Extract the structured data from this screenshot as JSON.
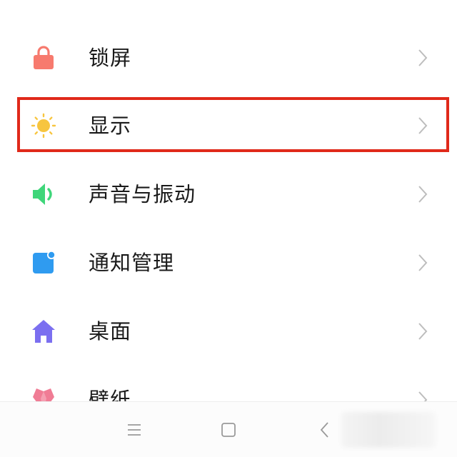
{
  "settings": {
    "items": [
      {
        "label": "锁屏",
        "icon": "lock-icon",
        "color": "#f77a6e"
      },
      {
        "label": "显示",
        "icon": "sun-icon",
        "color": "#f7c53f"
      },
      {
        "label": "声音与振动",
        "icon": "speaker-icon",
        "color": "#3fd67a"
      },
      {
        "label": "通知管理",
        "icon": "notification-icon",
        "color": "#2f9bf0"
      },
      {
        "label": "桌面",
        "icon": "home-icon",
        "color": "#7b6ff0"
      },
      {
        "label": "壁纸",
        "icon": "wallpaper-icon",
        "color": "#f07c95"
      }
    ],
    "highlighted_item": "显示",
    "highlight_color": "#e0291a"
  },
  "nav_bar": {
    "buttons": [
      "menu-icon",
      "home-square-icon",
      "back-icon"
    ]
  }
}
